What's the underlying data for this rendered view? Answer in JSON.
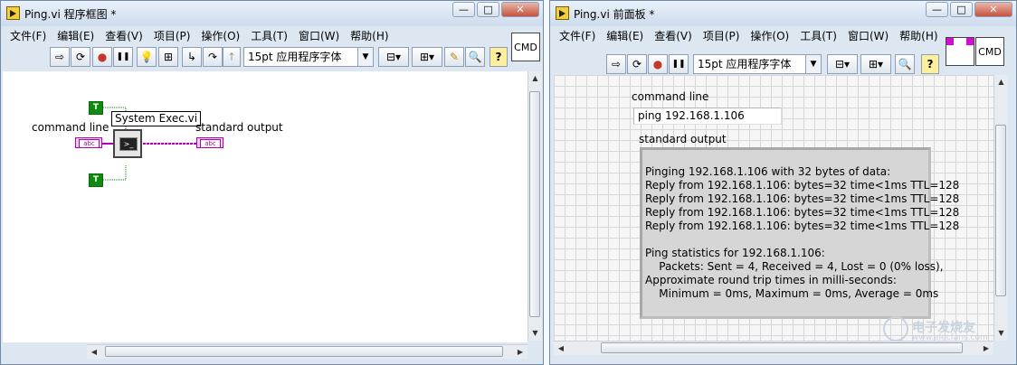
{
  "colors": {
    "string_wire": "#b400b4",
    "boolean_wire": "#108a10",
    "grid": "#d6d6d6"
  },
  "block_diagram": {
    "title": "Ping.vi 程序框图 *",
    "menu": [
      "文件(F)",
      "编辑(E)",
      "查看(V)",
      "项目(P)",
      "操作(O)",
      "工具(T)",
      "窗口(W)",
      "帮助(H)"
    ],
    "font_select": "15pt 应用程序字体",
    "cmd_label": "CMD",
    "bool_const": "T",
    "cmd_terminal_label": "command line",
    "cmd_terminal_text": "abc",
    "node_tip": "System Exec.vi",
    "node_icon_text": ">_",
    "out_terminal_label": "standard output",
    "out_terminal_text": "abc"
  },
  "front_panel": {
    "title": "Ping.vi 前面板 *",
    "menu": [
      "文件(F)",
      "编辑(E)",
      "查看(V)",
      "项目(P)",
      "操作(O)",
      "工具(T)",
      "窗口(W)",
      "帮助(H)"
    ],
    "font_select": "15pt 应用程序字体",
    "cmd_label": "CMD",
    "command_line_label": "command line",
    "command_line_value": "ping 192.168.1.106",
    "output_label": "standard output",
    "output_lines": [
      "Pinging 192.168.1.106 with 32 bytes of data:",
      "Reply from 192.168.1.106: bytes=32 time<1ms TTL=128",
      "Reply from 192.168.1.106: bytes=32 time<1ms TTL=128",
      "Reply from 192.168.1.106: bytes=32 time<1ms TTL=128",
      "Reply from 192.168.1.106: bytes=32 time<1ms TTL=128",
      "",
      "Ping statistics for 192.168.1.106:",
      "    Packets: Sent = 4, Received = 4, Lost = 0 (0% loss),",
      "Approximate round trip times in milli-seconds:",
      "    Minimum = 0ms, Maximum = 0ms, Average = 0ms"
    ]
  },
  "caption": {
    "minimize": "—",
    "maximize": "□",
    "close": "✕"
  },
  "toolbar_icons": {
    "run": "⇨",
    "run_continuous": "⟳",
    "abort": "●",
    "pause": "❚❚",
    "highlight": "💡",
    "retain": "⊞",
    "step_into": "↳",
    "step_over": "↷",
    "step_out": "↑",
    "align": "⊟▾",
    "distribute": "⊞▾",
    "resize": "⇲▾",
    "reorder": "⇅▾",
    "cleanup": "✎",
    "search": "🔍",
    "help": "?"
  },
  "watermark": {
    "brand": "电子发烧友",
    "site": "www.elecfans.com"
  }
}
